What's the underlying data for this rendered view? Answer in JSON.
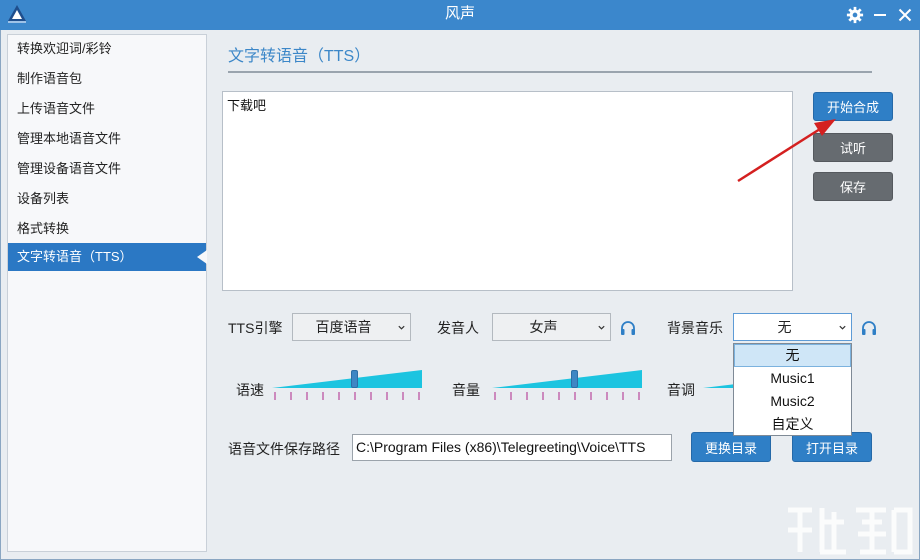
{
  "window": {
    "title": "风声"
  },
  "sidebar": {
    "items": [
      {
        "label": "转换欢迎词/彩铃"
      },
      {
        "label": "制作语音包"
      },
      {
        "label": "上传语音文件"
      },
      {
        "label": "管理本地语音文件"
      },
      {
        "label": "管理设备语音文件"
      },
      {
        "label": "设备列表"
      },
      {
        "label": "格式转换"
      },
      {
        "label": "文字转语音（TTS）",
        "active": true
      }
    ]
  },
  "main": {
    "heading": "文字转语音（TTS）",
    "text_content": "下载吧",
    "buttons": {
      "synthesize": "开始合成",
      "preview": "试听",
      "save": "保存",
      "change_dir": "更换目录",
      "open_dir": "打开目录"
    },
    "engine": {
      "label": "TTS引擎",
      "value": "百度语音"
    },
    "speaker": {
      "label": "发音人",
      "value": "女声"
    },
    "bg_music": {
      "label": "背景音乐",
      "value": "无",
      "options": [
        "无",
        "Music1",
        "Music2",
        "自定义"
      ]
    },
    "speed": {
      "label": "语速",
      "level": 0.55
    },
    "volume": {
      "label": "音量",
      "level": 0.55
    },
    "pitch": {
      "label": "音调"
    },
    "save_path": {
      "label": "语音文件保存路径",
      "value": "C:\\Program Files (x86)\\Telegreeting\\Voice\\TTS"
    }
  },
  "colors": {
    "titlebar": "#3b87cc",
    "accent_blue": "#2f7fc6",
    "gray_button": "#666b70",
    "slider_cyan": "#1cc4e0",
    "annotation_arrow": "#d42020"
  },
  "icons": [
    "logo-icon",
    "settings-gear-icon",
    "minimize-icon",
    "close-icon",
    "headphone-icon",
    "chevron-down-icon"
  ]
}
